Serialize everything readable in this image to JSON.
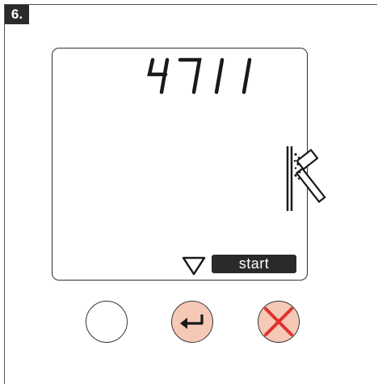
{
  "step": {
    "label": "6."
  },
  "display": {
    "value": "4711",
    "softkey_label": "start",
    "mode_icon": "chiselling-hammer-icon",
    "nav_icon": "triangle-down-icon"
  },
  "buttons": [
    {
      "name": "blank-button",
      "icon": "none"
    },
    {
      "name": "enter-button",
      "icon": "enter-arrow-icon"
    },
    {
      "name": "cancel-button",
      "icon": "cancel-x-icon"
    }
  ],
  "colors": {
    "button_fill": "#f6c9b6",
    "cancel_x": "#e0312e",
    "lcd_dark": "#2a2a2a"
  }
}
